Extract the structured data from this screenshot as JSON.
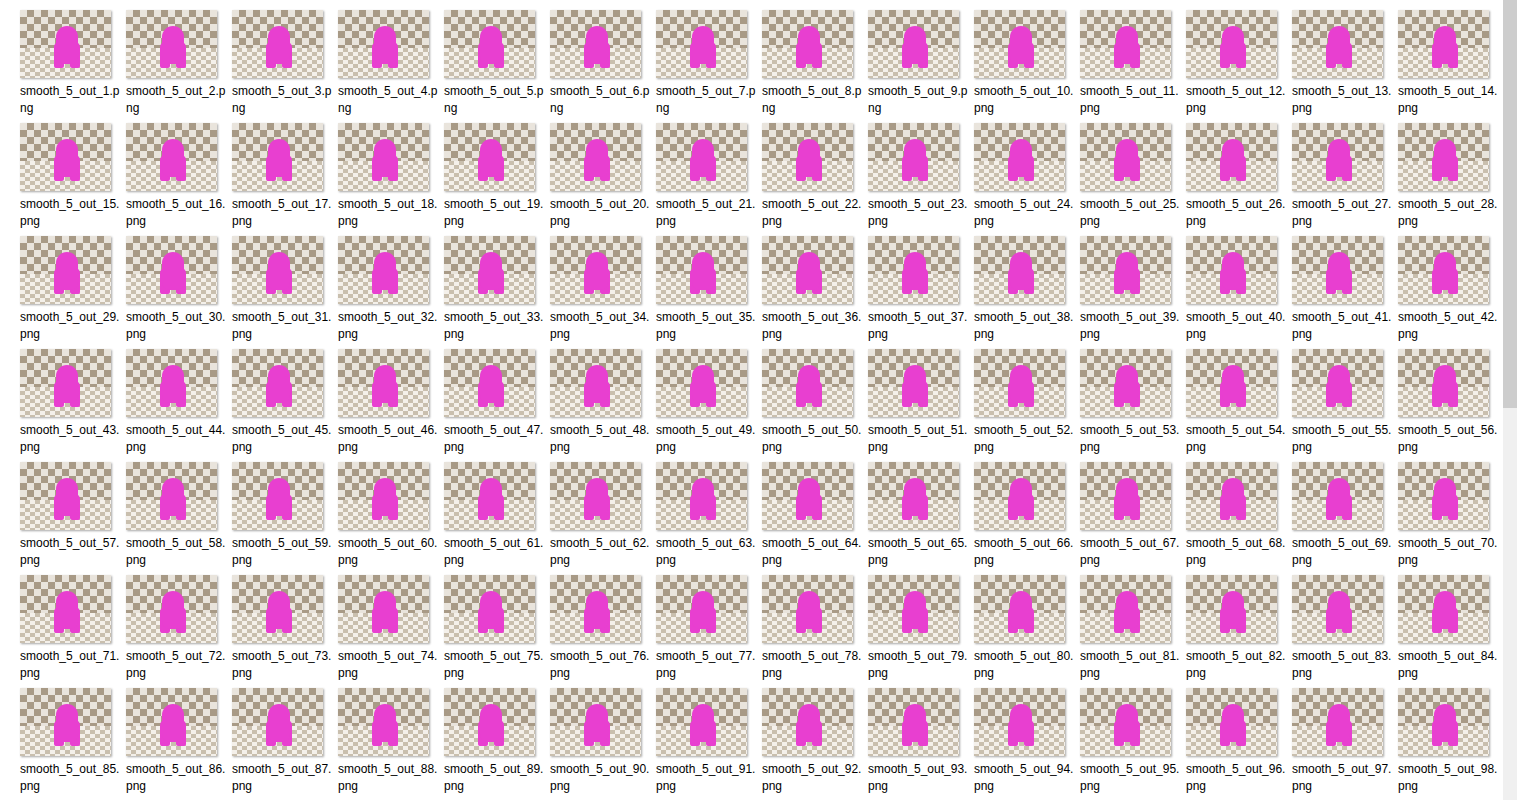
{
  "view": "thumbnails",
  "scrollbar": {
    "level": 0.51
  },
  "files": [
    {
      "name": "smooth_5_out_1.png",
      "selected": false
    },
    {
      "name": "smooth_5_out_2.png",
      "selected": false
    },
    {
      "name": "smooth_5_out_3.png",
      "selected": false
    },
    {
      "name": "smooth_5_out_4.png",
      "selected": false
    },
    {
      "name": "smooth_5_out_5.png",
      "selected": false
    },
    {
      "name": "smooth_5_out_6.png",
      "selected": false
    },
    {
      "name": "smooth_5_out_7.png",
      "selected": false
    },
    {
      "name": "smooth_5_out_8.png",
      "selected": false
    },
    {
      "name": "smooth_5_out_9.png",
      "selected": false
    },
    {
      "name": "smooth_5_out_10.png",
      "selected": false
    },
    {
      "name": "smooth_5_out_11.png",
      "selected": false
    },
    {
      "name": "smooth_5_out_12.png",
      "selected": false
    },
    {
      "name": "smooth_5_out_13.png",
      "selected": false
    },
    {
      "name": "smooth_5_out_14.png",
      "selected": false
    },
    {
      "name": "smooth_5_out_15.png",
      "selected": false
    },
    {
      "name": "smooth_5_out_16.png",
      "selected": false
    },
    {
      "name": "smooth_5_out_17.png",
      "selected": false
    },
    {
      "name": "smooth_5_out_18.png",
      "selected": false
    },
    {
      "name": "smooth_5_out_19.png",
      "selected": false
    },
    {
      "name": "smooth_5_out_20.png",
      "selected": false
    },
    {
      "name": "smooth_5_out_21.png",
      "selected": false
    },
    {
      "name": "smooth_5_out_22.png",
      "selected": false
    },
    {
      "name": "smooth_5_out_23.png",
      "selected": false
    },
    {
      "name": "smooth_5_out_24.png",
      "selected": false
    },
    {
      "name": "smooth_5_out_25.png",
      "selected": false
    },
    {
      "name": "smooth_5_out_26.png",
      "selected": false
    },
    {
      "name": "smooth_5_out_27.png",
      "selected": false
    },
    {
      "name": "smooth_5_out_28.png",
      "selected": false
    },
    {
      "name": "smooth_5_out_29.png",
      "selected": false
    },
    {
      "name": "smooth_5_out_30.png",
      "selected": false
    },
    {
      "name": "smooth_5_out_31.png",
      "selected": false
    },
    {
      "name": "smooth_5_out_32.png",
      "selected": false
    },
    {
      "name": "smooth_5_out_33.png",
      "selected": false
    },
    {
      "name": "smooth_5_out_34.png",
      "selected": false
    },
    {
      "name": "smooth_5_out_35.png",
      "selected": false
    },
    {
      "name": "smooth_5_out_36.png",
      "selected": false
    },
    {
      "name": "smooth_5_out_37.png",
      "selected": false
    },
    {
      "name": "smooth_5_out_38.png",
      "selected": false
    },
    {
      "name": "smooth_5_out_39.png",
      "selected": false
    },
    {
      "name": "smooth_5_out_40.png",
      "selected": false
    },
    {
      "name": "smooth_5_out_41.png",
      "selected": false
    },
    {
      "name": "smooth_5_out_42.png",
      "selected": false
    },
    {
      "name": "smooth_5_out_43.png",
      "selected": false
    },
    {
      "name": "smooth_5_out_44.png",
      "selected": false
    },
    {
      "name": "smooth_5_out_45.png",
      "selected": false
    },
    {
      "name": "smooth_5_out_46.png",
      "selected": false
    },
    {
      "name": "smooth_5_out_47.png",
      "selected": false
    },
    {
      "name": "smooth_5_out_48.png",
      "selected": false
    },
    {
      "name": "smooth_5_out_49.png",
      "selected": false
    },
    {
      "name": "smooth_5_out_50.png",
      "selected": false
    },
    {
      "name": "smooth_5_out_51.png",
      "selected": false
    },
    {
      "name": "smooth_5_out_52.png",
      "selected": false
    },
    {
      "name": "smooth_5_out_53.png",
      "selected": false
    },
    {
      "name": "smooth_5_out_54.png",
      "selected": false
    },
    {
      "name": "smooth_5_out_55.png",
      "selected": false
    },
    {
      "name": "smooth_5_out_56.png",
      "selected": false
    },
    {
      "name": "smooth_5_out_57.png",
      "selected": false
    },
    {
      "name": "smooth_5_out_58.png",
      "selected": false
    },
    {
      "name": "smooth_5_out_59.png",
      "selected": false
    },
    {
      "name": "smooth_5_out_60.png",
      "selected": false
    },
    {
      "name": "smooth_5_out_61.png",
      "selected": false
    },
    {
      "name": "smooth_5_out_62.png",
      "selected": false
    },
    {
      "name": "smooth_5_out_63.png",
      "selected": false
    },
    {
      "name": "smooth_5_out_64.png",
      "selected": false
    },
    {
      "name": "smooth_5_out_65.png",
      "selected": false
    },
    {
      "name": "smooth_5_out_66.png",
      "selected": false
    },
    {
      "name": "smooth_5_out_67.png",
      "selected": false
    },
    {
      "name": "smooth_5_out_68.png",
      "selected": false
    },
    {
      "name": "smooth_5_out_69.png",
      "selected": false
    },
    {
      "name": "smooth_5_out_70.png",
      "selected": false
    },
    {
      "name": "smooth_5_out_71.png",
      "selected": false
    },
    {
      "name": "smooth_5_out_72.png",
      "selected": false
    },
    {
      "name": "smooth_5_out_73.png",
      "selected": false
    },
    {
      "name": "smooth_5_out_74.png",
      "selected": false
    },
    {
      "name": "smooth_5_out_75.png",
      "selected": false
    },
    {
      "name": "smooth_5_out_76.png",
      "selected": false
    },
    {
      "name": "smooth_5_out_77.png",
      "selected": false
    },
    {
      "name": "smooth_5_out_78.png",
      "selected": false
    },
    {
      "name": "smooth_5_out_79.png",
      "selected": false
    },
    {
      "name": "smooth_5_out_80.png",
      "selected": false
    },
    {
      "name": "smooth_5_out_81.png",
      "selected": false
    },
    {
      "name": "smooth_5_out_82.png",
      "selected": false
    },
    {
      "name": "smooth_5_out_83.png",
      "selected": false
    },
    {
      "name": "smooth_5_out_84.png",
      "selected": false
    },
    {
      "name": "smooth_5_out_85.png",
      "selected": false
    },
    {
      "name": "smooth_5_out_86.png",
      "selected": false
    },
    {
      "name": "smooth_5_out_87.png",
      "selected": false
    },
    {
      "name": "smooth_5_out_88.png",
      "selected": false
    },
    {
      "name": "smooth_5_out_89.png",
      "selected": false
    },
    {
      "name": "smooth_5_out_90.png",
      "selected": false
    },
    {
      "name": "smooth_5_out_91.png",
      "selected": false
    },
    {
      "name": "smooth_5_out_92.png",
      "selected": false
    },
    {
      "name": "smooth_5_out_93.png",
      "selected": false
    },
    {
      "name": "smooth_5_out_94.png",
      "selected": false
    },
    {
      "name": "smooth_5_out_95.png",
      "selected": false
    },
    {
      "name": "smooth_5_out_96.png",
      "selected": false
    },
    {
      "name": "smooth_5_out_97.png",
      "selected": false
    },
    {
      "name": "smooth_5_out_98.png",
      "selected": false
    }
  ]
}
